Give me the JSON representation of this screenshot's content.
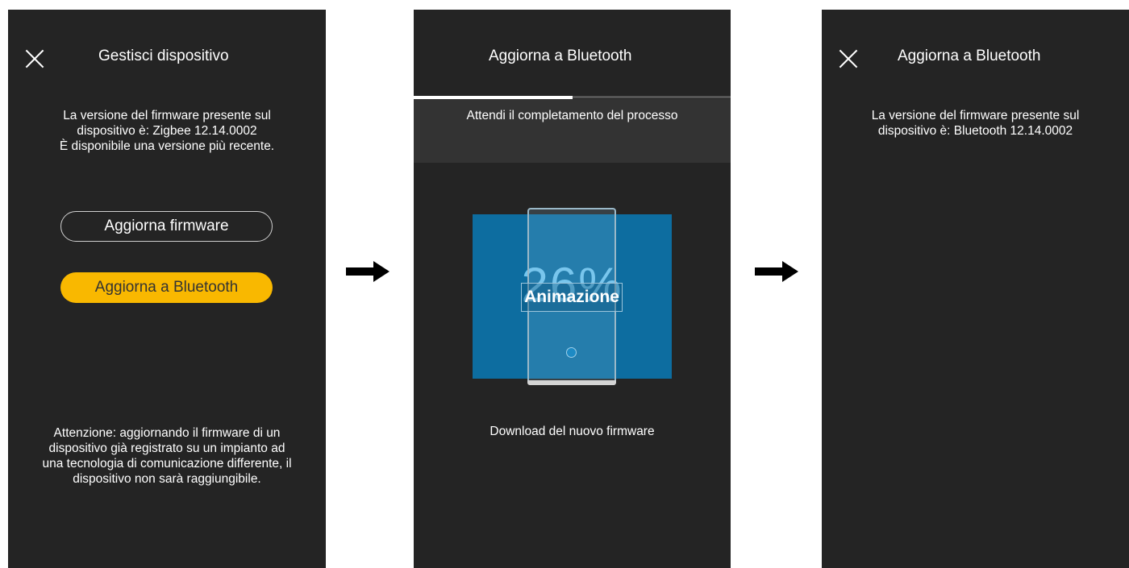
{
  "screen1": {
    "title": "Gestisci dispositivo",
    "firmware_info": "La versione del firmware presente sul\ndispositivo è: Zigbee 12.14.0002\nÈ disponibile una versione più recente.",
    "update_firmware_button": "Aggiorna firmware",
    "update_bluetooth_button": "Aggiorna a Bluetooth",
    "warning": "Attenzione: aggiornando il firmware di un\ndispositivo già registrato su un impianto ad\nuna tecnologia di comunicazione differente, il\ndispositivo non sarà raggiungibile."
  },
  "screen2": {
    "title": "Aggiorna a Bluetooth",
    "progress_fraction": 0.5,
    "wait_message": "Attendi il completamento del processo",
    "percent": "26%",
    "animation_label": "Animazione",
    "status": "Download del nuovo firmware"
  },
  "screen3": {
    "title": "Aggiorna a Bluetooth",
    "firmware_info": "La versione del firmware presente sul\ndispositivo è: Bluetooth 12.14.0002"
  },
  "icons": [
    "close-icon",
    "arrow-right-icon"
  ],
  "colors": {
    "screen_bg": "#242424",
    "accent": "#f9b800",
    "animation_bg": "#0d6da0",
    "percent_text": "#73c6ef"
  }
}
